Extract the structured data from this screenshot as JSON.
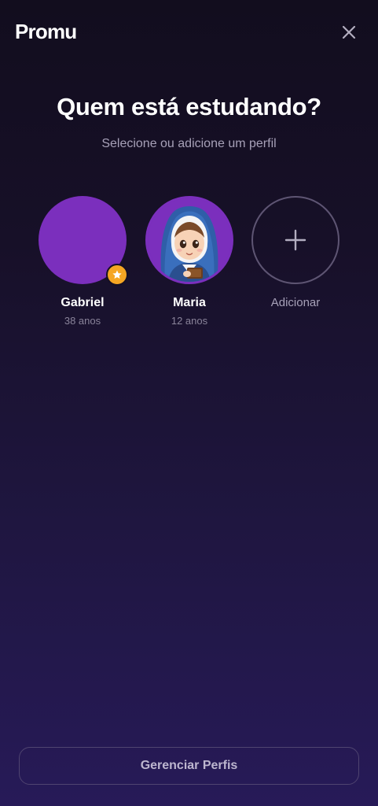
{
  "app": {
    "brand": "Promu"
  },
  "header": {
    "title": "Quem está estudando?",
    "subtitle": "Selecione ou adicione um perfil"
  },
  "profiles": [
    {
      "name": "Gabriel",
      "age": "38 anos",
      "avatar_color": "#7b2fbd",
      "badge": "star-icon",
      "badge_color": "#f5a623"
    },
    {
      "name": "Maria",
      "age": "12 anos",
      "avatar": "nun-character-illustration",
      "avatar_color": "#7b2fbd"
    }
  ],
  "add_profile": {
    "label": "Adicionar",
    "icon": "plus-icon"
  },
  "footer": {
    "manage_label": "Gerenciar Perfis"
  },
  "icons": {
    "close": "close-icon"
  }
}
